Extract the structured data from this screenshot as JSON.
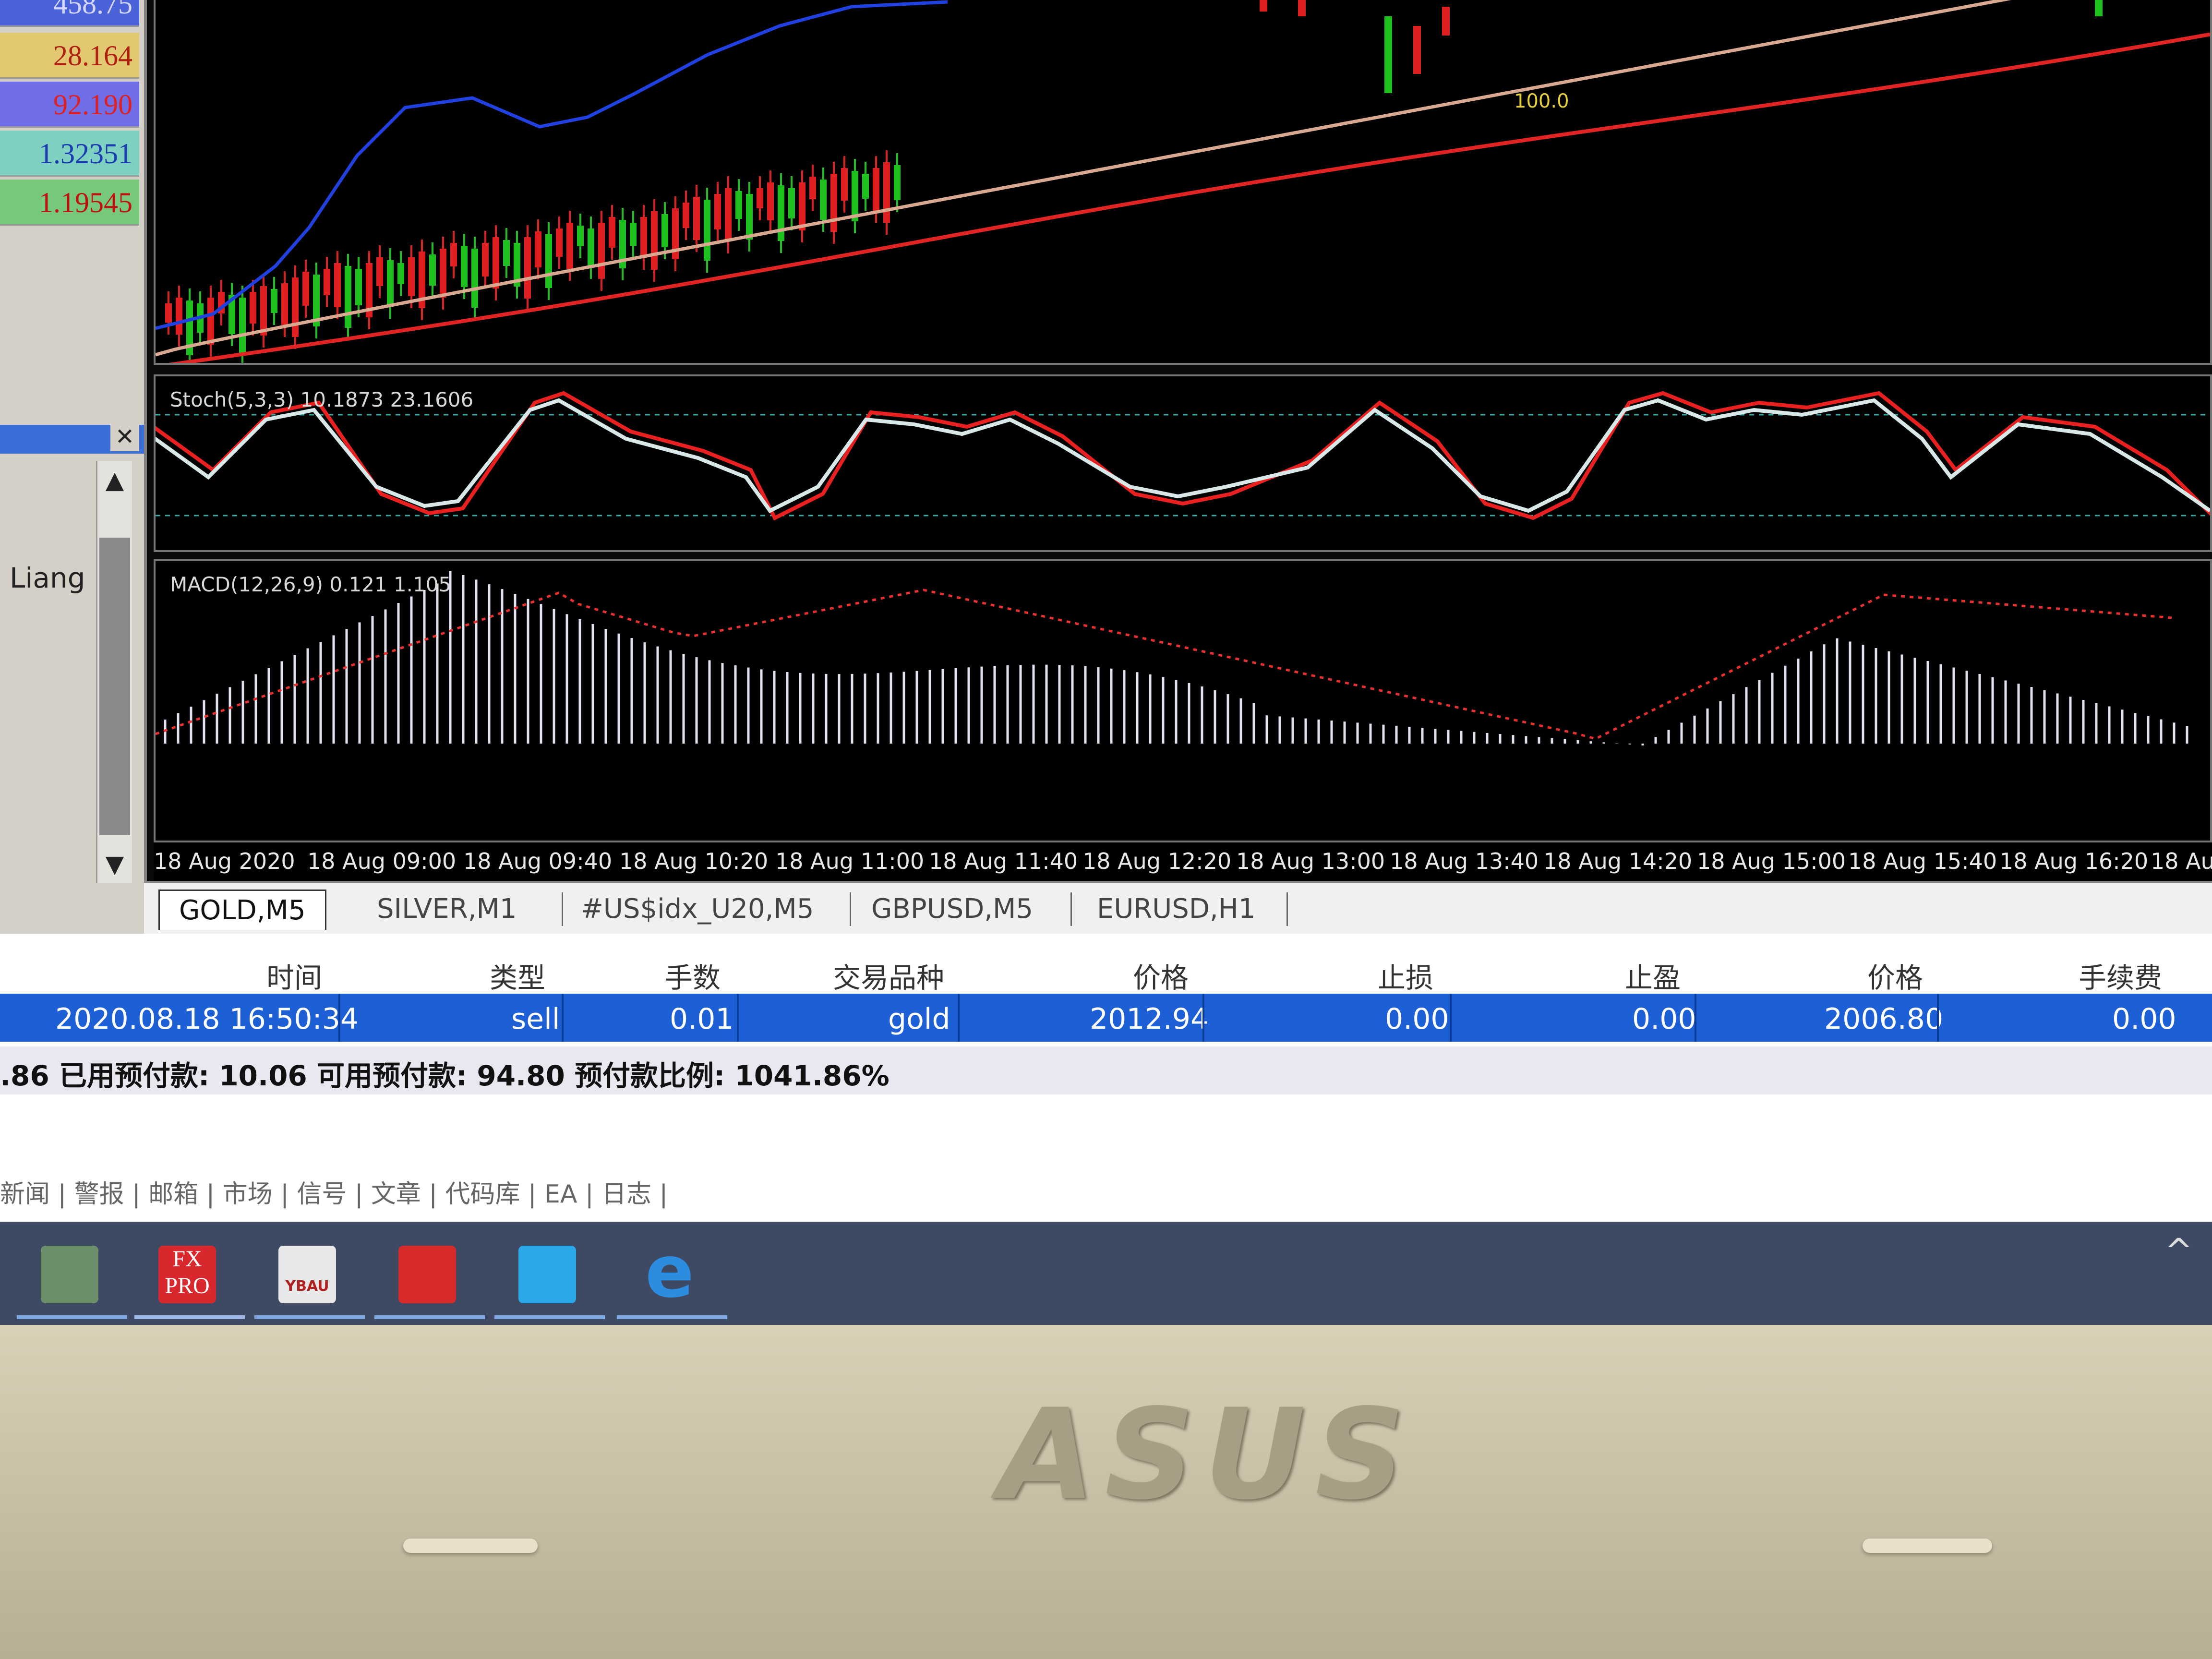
{
  "quotes": [
    {
      "value": "458.75",
      "bg": "#4a63d8",
      "color": "#d8d8ff"
    },
    {
      "value": "28.164",
      "bg": "#e2c870",
      "color": "#b02010"
    },
    {
      "value": "92.190",
      "bg": "#6f6ee6",
      "color": "#e02020"
    },
    {
      "value": "1.32351",
      "bg": "#7ed0c0",
      "color": "#1a3ab0"
    },
    {
      "value": "1.19545",
      "bg": "#76c87a",
      "color": "#c01010"
    }
  ],
  "navigator": {
    "close": "✕",
    "user": "Liang",
    "up": "▲",
    "down": "▼"
  },
  "main_chart": {
    "marker_label": "100.0"
  },
  "stoch": {
    "label": "Stoch(5,3,3) 10.1873 23.1606"
  },
  "macd": {
    "label": "MACD(12,26,9) 0.121 1.105"
  },
  "time_axis": [
    "18 Aug 2020",
    "18 Aug 09:00",
    "18 Aug 09:40",
    "18 Aug 10:20",
    "18 Aug 11:00",
    "18 Aug 11:40",
    "18 Aug 12:20",
    "18 Aug 13:00",
    "18 Aug 13:40",
    "18 Aug 14:20",
    "18 Aug 15:00",
    "18 Aug 15:40",
    "18 Aug 16:20",
    "18 Aug"
  ],
  "chart_tabs": [
    "GOLD,M5",
    "SILVER,M1",
    "#US$idx_U20,M5",
    "GBPUSD,M5",
    "EURUSD,H1"
  ],
  "terminal": {
    "headers": [
      "时间",
      "类型",
      "手数",
      "交易品种",
      "价格",
      "止损",
      "止盈",
      "价格",
      "手续费"
    ],
    "row": [
      "2020.08.18 16:50:34",
      "sell",
      "0.01",
      "gold",
      "2012.94",
      "0.00",
      "0.00",
      "2006.80",
      "0.00"
    ],
    "summary": ".86  已用预付款: 10.06   可用预付款: 94.80   预付款比例: 1041.86%",
    "bottom_tabs": "新闻  |  警报  |  邮箱  |  市场  |  信号  |  文章  |  代码库  |  EA  |  日志  |"
  },
  "taskbar": {
    "icons": [
      {
        "name": "metatrader-icon",
        "color": "#6b8e6b"
      },
      {
        "name": "fxpro-icon",
        "label": "FX PRO",
        "color": "#d8282e"
      },
      {
        "name": "ybau-icon",
        "label": "YBAU",
        "color": "#e8e8e8"
      },
      {
        "name": "chart-app-icon",
        "color": "#d82a2a"
      },
      {
        "name": "arrow-app-icon",
        "color": "#2aa8e8"
      },
      {
        "name": "edge-icon",
        "label": "e",
        "color": "#2c8ce0"
      }
    ],
    "tray": "^"
  },
  "bezel": {
    "brand": "ASUS"
  }
}
